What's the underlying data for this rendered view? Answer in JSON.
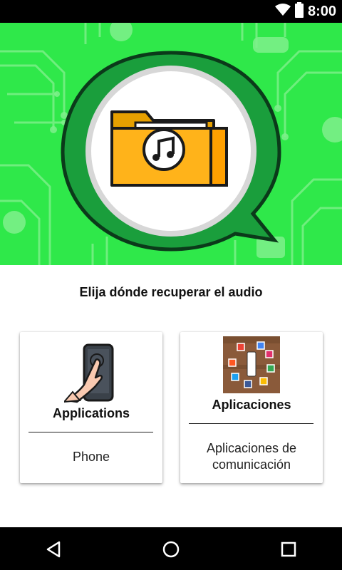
{
  "status_bar": {
    "time": "8:00",
    "icons": [
      "wifi-icon",
      "battery-icon"
    ]
  },
  "hero": {
    "image": "folder-music-icon in chat bubble",
    "background_color": "#2fe84a",
    "bubble_color": "#1a9e3c",
    "folder_color": "#ffb31a"
  },
  "header": {
    "title": "Elija dónde recuperar el audio"
  },
  "cards": [
    {
      "title": "Applications",
      "description": "Phone",
      "icon": "hand-touch-phone-icon"
    },
    {
      "title": "Aplicaciones",
      "description": "Aplicaciones de comunicación",
      "icon": "apps-around-phone-icon"
    }
  ],
  "nav": {
    "buttons": [
      "back-button",
      "home-button",
      "recents-button"
    ]
  }
}
